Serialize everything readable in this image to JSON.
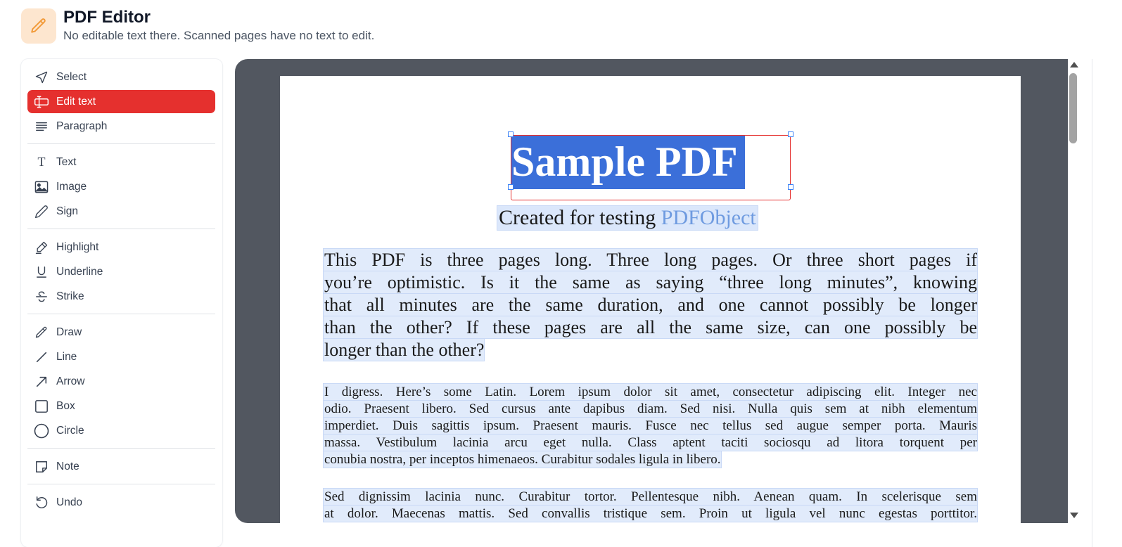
{
  "app": {
    "title": "PDF Editor",
    "subtitle": "No editable text there. Scanned pages have no text to edit.",
    "icon": "pencil-icon",
    "icon_bg": "#fde6cf",
    "icon_color": "#f29a38"
  },
  "sidebar": {
    "accent": "#e5302e",
    "groups": [
      [
        {
          "label": "Select",
          "icon": "cursor-icon"
        },
        {
          "label": "Edit text",
          "icon": "edit-text-icon",
          "active": true
        },
        {
          "label": "Paragraph",
          "icon": "paragraph-icon"
        }
      ],
      [
        {
          "label": "Text",
          "icon": "text-icon"
        },
        {
          "label": "Image",
          "icon": "image-icon"
        },
        {
          "label": "Sign",
          "icon": "pen-icon"
        }
      ],
      [
        {
          "label": "Highlight",
          "icon": "highlighter-icon"
        },
        {
          "label": "Underline",
          "icon": "underline-icon"
        },
        {
          "label": "Strike",
          "icon": "strikethrough-icon"
        }
      ],
      [
        {
          "label": "Draw",
          "icon": "pencil-icon"
        },
        {
          "label": "Line",
          "icon": "line-icon"
        },
        {
          "label": "Arrow",
          "icon": "arrow-icon"
        },
        {
          "label": "Box",
          "icon": "square-icon"
        },
        {
          "label": "Circle",
          "icon": "circle-icon"
        }
      ],
      [
        {
          "label": "Note",
          "icon": "note-icon"
        }
      ],
      [
        {
          "label": "Undo",
          "icon": "undo-icon"
        }
      ]
    ]
  },
  "document": {
    "title": "Sample PDF",
    "subtitle_prefix": "Created for testing ",
    "subtitle_link": "PDFObject",
    "paragraph1": [
      "This PDF is three pages long. Three long pages. Or three short pages if",
      "you’re optimistic. Is it the same as saying “three long minutes”, knowing",
      "that all minutes are the same duration, and one cannot possibly be longer",
      "than the other? If these pages are all the same size, can one possibly be",
      "longer than the other?"
    ],
    "paragraph2": [
      "I digress. Here’s some Latin. Lorem ipsum dolor sit amet, consectetur adipiscing elit. Integer nec",
      "odio. Praesent libero. Sed cursus ante dapibus diam. Sed nisi. Nulla quis sem at nibh elementum",
      "imperdiet. Duis sagittis ipsum. Praesent mauris. Fusce nec tellus sed augue semper porta. Mauris",
      "massa. Vestibulum lacinia arcu eget nulla. Class aptent taciti sociosqu ad litora torquent per",
      "conubia nostra, per inceptos himenaeos. Curabitur sodales ligula in libero."
    ],
    "paragraph3": [
      "Sed dignissim lacinia nunc. Curabitur tortor. Pellentesque nibh. Aenean quam. In scelerisque sem",
      "at dolor. Maecenas mattis. Sed convallis tristique sem. Proin ut ligula vel nunc egestas porttitor."
    ],
    "selection_color": "#3b6fd9",
    "text_highlight_color": "#e1ebfb"
  }
}
